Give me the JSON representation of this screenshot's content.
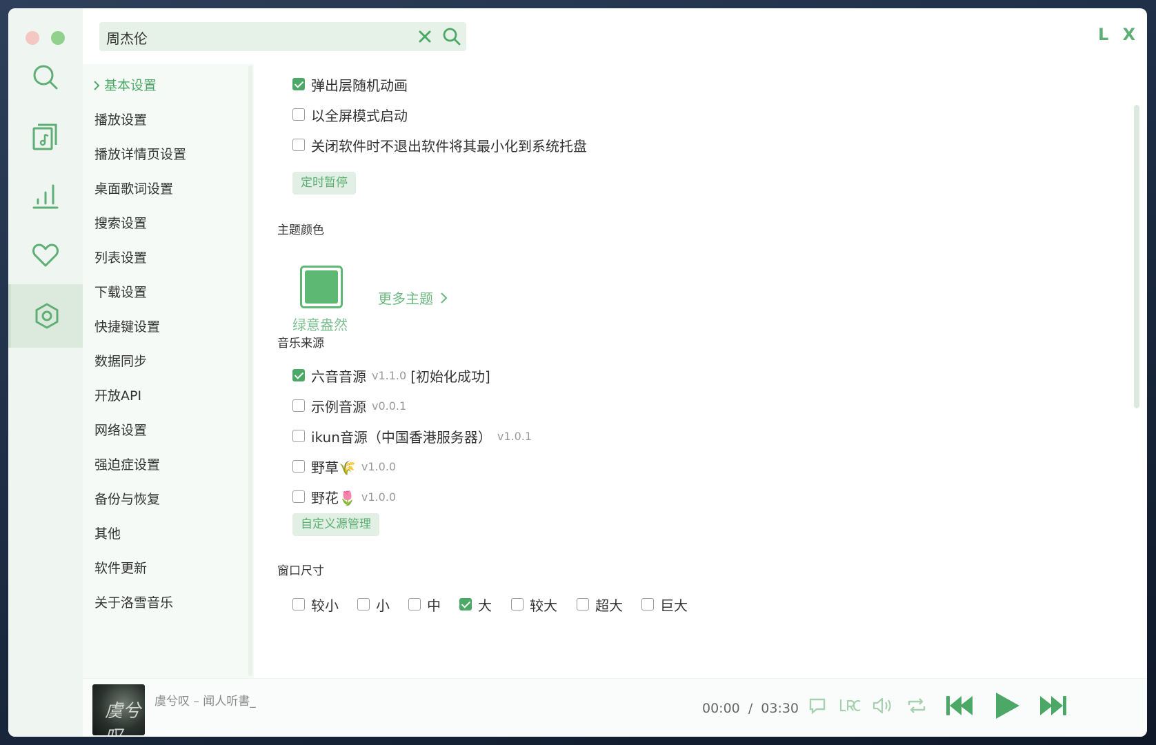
{
  "header": {
    "search_value": "周杰伦",
    "logo": "L X"
  },
  "rail": {
    "icons": [
      "search-icon",
      "music-list-icon",
      "chart-icon",
      "heart-icon",
      "settings-icon"
    ],
    "active": "settings-icon"
  },
  "settings_nav": {
    "items": [
      {
        "label": "基本设置",
        "active": true
      },
      {
        "label": "播放设置"
      },
      {
        "label": "播放详情页设置"
      },
      {
        "label": "桌面歌词设置"
      },
      {
        "label": "搜索设置"
      },
      {
        "label": "列表设置"
      },
      {
        "label": "下载设置"
      },
      {
        "label": "快捷键设置"
      },
      {
        "label": "数据同步"
      },
      {
        "label": "开放API"
      },
      {
        "label": "网络设置"
      },
      {
        "label": "强迫症设置"
      },
      {
        "label": "备份与恢复"
      },
      {
        "label": "其他"
      },
      {
        "label": "软件更新"
      },
      {
        "label": "关于洛雪音乐"
      }
    ]
  },
  "basic": {
    "options": [
      {
        "label": "弹出层随机动画",
        "checked": true
      },
      {
        "label": "以全屏模式启动",
        "checked": false
      },
      {
        "label": "关闭软件时不退出软件将其最小化到系统托盘",
        "checked": false
      }
    ],
    "timer_button": "定时暂停"
  },
  "theme": {
    "title": "主题颜色",
    "current": "绿意盎然",
    "current_color": "#5db873",
    "more": "更多主题"
  },
  "sources": {
    "title": "音乐来源",
    "items": [
      {
        "label": "六音音源",
        "version": "v1.1.0",
        "status": "[初始化成功]",
        "checked": true
      },
      {
        "label": "示例音源",
        "version": "v0.0.1",
        "checked": false
      },
      {
        "label": "ikun音源（中国香港服务器）",
        "version": "v1.0.1",
        "checked": false
      },
      {
        "label": "野草🌾",
        "version": "v1.0.0",
        "checked": false
      },
      {
        "label": "野花🌷",
        "version": "v1.0.0",
        "checked": false
      }
    ],
    "manage_button": "自定义源管理"
  },
  "window_size": {
    "title": "窗口尺寸",
    "options": [
      {
        "label": "较小",
        "checked": false
      },
      {
        "label": "小",
        "checked": false
      },
      {
        "label": "中",
        "checked": false
      },
      {
        "label": "大",
        "checked": true
      },
      {
        "label": "较大",
        "checked": false
      },
      {
        "label": "超大",
        "checked": false
      },
      {
        "label": "巨大",
        "checked": false
      }
    ]
  },
  "player": {
    "track": "虞兮叹 – 闻人听書_",
    "cover_text": "虞兮叹",
    "current_time": "00:00",
    "separator": "/",
    "duration": "03:30",
    "accent_color": "#4ca866"
  }
}
